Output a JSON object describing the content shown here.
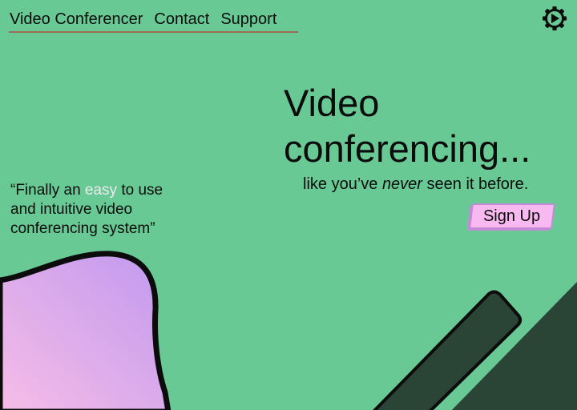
{
  "nav": {
    "items": [
      {
        "label": "Video Conferencer"
      },
      {
        "label": "Contact"
      },
      {
        "label": "Support"
      }
    ]
  },
  "icons": {
    "settings": "gear-icon"
  },
  "hero": {
    "title": "Video\nconferencing...",
    "subtitle_before": "like you’ve ",
    "subtitle_emphasis": "never",
    "subtitle_after": " seen it before.",
    "cta_label": "Sign Up"
  },
  "quote": {
    "before": "“Finally an ",
    "highlight": "easy",
    "after": " to use and intuitive video conferencing system”"
  },
  "colors": {
    "background": "#68c994",
    "accent_pink": "#f7b9f0",
    "accent_purple": "#c58ad7",
    "dark_green": "#2a4435",
    "nav_underline": "#9b6b55"
  }
}
